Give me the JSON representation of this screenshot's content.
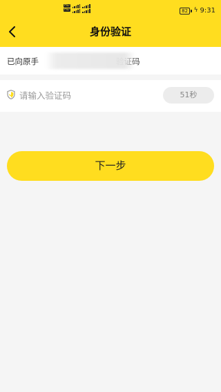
{
  "status_bar": {
    "sim_badges": [
      "HD",
      "HD"
    ],
    "battery": "82",
    "time": "9:31"
  },
  "nav": {
    "back_icon": "chevron-left-icon",
    "title": "身份验证"
  },
  "notice": {
    "text_start": "已向原手",
    "text_end": "验证码"
  },
  "code": {
    "icon": "shield-check-icon",
    "placeholder": "请输入验证码",
    "value": "",
    "timer_label": "51秒"
  },
  "actions": {
    "next_label": "下一步"
  },
  "colors": {
    "brand_yellow": "#ffdd1f",
    "background": "#f5f5f5",
    "timer_bg": "#ececec"
  }
}
